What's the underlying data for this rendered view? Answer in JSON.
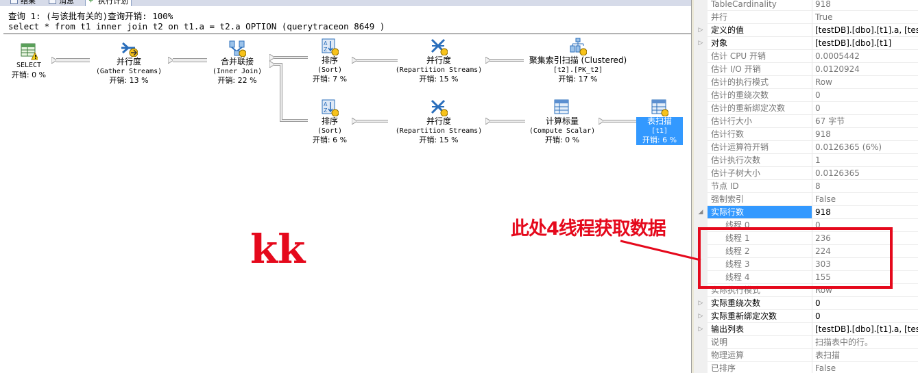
{
  "tabs": [
    "结果",
    "消息",
    "执行计划"
  ],
  "query": {
    "line1": "查询 1: (与该批有关的)查询开销: 100%",
    "line2": "select * from t1 inner join t2 on t1.a = t2.a OPTION (querytraceon 8649 )"
  },
  "nodes": {
    "select": {
      "name": "SELECT",
      "sub": "",
      "cost": "开销: 0 %"
    },
    "gather": {
      "name": "并行度",
      "sub": "(Gather Streams)",
      "cost": "开销: 13 %"
    },
    "join": {
      "name": "合并联接",
      "sub": "(Inner Join)",
      "cost": "开销: 22 %"
    },
    "sort1": {
      "name": "排序",
      "sub": "(Sort)",
      "cost": "开销: 7 %"
    },
    "repart1": {
      "name": "并行度",
      "sub": "(Repartition Streams)",
      "cost": "开销: 15 %"
    },
    "clustered": {
      "name": "聚集索引扫描 (Clustered)",
      "sub": "[t2].[PK_t2]",
      "cost": "开销: 17 %"
    },
    "sort2": {
      "name": "排序",
      "sub": "(Sort)",
      "cost": "开销: 6 %"
    },
    "repart2": {
      "name": "并行度",
      "sub": "(Repartition Streams)",
      "cost": "开销: 15 %"
    },
    "compute": {
      "name": "计算标量",
      "sub": "(Compute Scalar)",
      "cost": "开销: 0 %"
    },
    "tablescan": {
      "name": "表扫描",
      "sub": "[t1]",
      "cost": "开销: 6 %"
    }
  },
  "overlay_text": "kk",
  "annotation": "此处4线程获取数据",
  "properties": [
    {
      "n": "TableCardinality",
      "v": "918",
      "ro": true,
      "exp": ""
    },
    {
      "n": "并行",
      "v": "True",
      "ro": true,
      "exp": ""
    },
    {
      "n": "定义的值",
      "v": "[testDB].[dbo].[t1].a, [testDB].[dbo]",
      "ro": false,
      "exp": "▷"
    },
    {
      "n": "对象",
      "v": "[testDB].[dbo].[t1]",
      "ro": false,
      "exp": "▷"
    },
    {
      "n": "估计 CPU 开销",
      "v": "0.0005442",
      "ro": true,
      "exp": ""
    },
    {
      "n": "估计 I/O 开销",
      "v": "0.0120924",
      "ro": true,
      "exp": ""
    },
    {
      "n": "估计的执行模式",
      "v": "Row",
      "ro": true,
      "exp": ""
    },
    {
      "n": "估计的重绕次数",
      "v": "0",
      "ro": true,
      "exp": ""
    },
    {
      "n": "估计的重新绑定次数",
      "v": "0",
      "ro": true,
      "exp": ""
    },
    {
      "n": "估计行大小",
      "v": "67 字节",
      "ro": true,
      "exp": ""
    },
    {
      "n": "估计行数",
      "v": "918",
      "ro": true,
      "exp": ""
    },
    {
      "n": "估计运算符开销",
      "v": "0.0126365 (6%)",
      "ro": true,
      "exp": ""
    },
    {
      "n": "估计执行次数",
      "v": "1",
      "ro": true,
      "exp": ""
    },
    {
      "n": "估计子树大小",
      "v": "0.0126365",
      "ro": true,
      "exp": ""
    },
    {
      "n": "节点 ID",
      "v": "8",
      "ro": true,
      "exp": ""
    },
    {
      "n": "强制索引",
      "v": "False",
      "ro": true,
      "exp": ""
    },
    {
      "n": "实际行数",
      "v": "918",
      "ro": false,
      "exp": "◢",
      "hi": true
    },
    {
      "n": "线程 0",
      "v": "0",
      "ro": true,
      "exp": "",
      "child": true
    },
    {
      "n": "线程 1",
      "v": "236",
      "ro": true,
      "exp": "",
      "child": true
    },
    {
      "n": "线程 2",
      "v": "224",
      "ro": true,
      "exp": "",
      "child": true
    },
    {
      "n": "线程 3",
      "v": "303",
      "ro": true,
      "exp": "",
      "child": true
    },
    {
      "n": "线程 4",
      "v": "155",
      "ro": true,
      "exp": "",
      "child": true
    },
    {
      "n": "实际执行模式",
      "v": "Row",
      "ro": true,
      "exp": ""
    },
    {
      "n": "实际重绕次数",
      "v": "0",
      "ro": false,
      "exp": "▷"
    },
    {
      "n": "实际重新绑定次数",
      "v": "0",
      "ro": false,
      "exp": "▷"
    },
    {
      "n": "输出列表",
      "v": "[testDB].[dbo].[t1].a, [testDB].[dbo]",
      "ro": false,
      "exp": "▷"
    },
    {
      "n": "说明",
      "v": "扫描表中的行。",
      "ro": true,
      "exp": ""
    },
    {
      "n": "物理运算",
      "v": "表扫描",
      "ro": true,
      "exp": ""
    },
    {
      "n": "已排序",
      "v": "False",
      "ro": true,
      "exp": ""
    }
  ]
}
